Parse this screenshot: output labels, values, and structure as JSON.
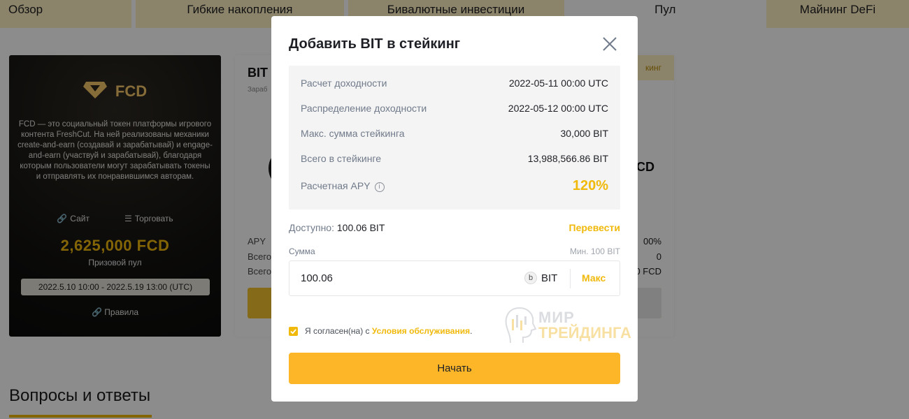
{
  "tabs": [
    {
      "label": "Обзор"
    },
    {
      "label": "Гибкие накопления"
    },
    {
      "label": "Бивалютные инвестиции"
    },
    {
      "label": "Пул"
    },
    {
      "label": "Майнинг DeFi"
    }
  ],
  "fcd_card": {
    "token": "FCD",
    "description": "FCD — это социальный токен платформы игрового контента FreshCut. На ней реализованы механики create-and-earn (создавай и зарабатывай) и engage-and-earn (участвуй и зарабатывай), благодаря которым пользователи могут зарабатывать токены и отправлять их понравившимся авторам.",
    "site_label": "Сайт",
    "trade_label": "Торговать",
    "prize_amount": "2,625,000 FCD",
    "prize_label": "Призовой пул",
    "period": "2022.5.10 10:00 - 2022.5.19 13:00 (UTC)",
    "rules_label": "Правила",
    "accent": "#f0b90b"
  },
  "pool_card": {
    "title": "BIT",
    "subtitle": "Зараб",
    "badge": "кинг",
    "right_token": "CD",
    "apy_label": "APY",
    "row2_label": "Всего",
    "row3_label": "Всего",
    "apy_value": "00%",
    "row2_value": "0",
    "row3_value": "0 FCD"
  },
  "faq": {
    "title": "Вопросы и ответы"
  },
  "modal": {
    "title": "Добавить BIT в стейкинг",
    "info": {
      "calc_label": "Расчет доходности",
      "calc_value": "2022-05-11 00:00 UTC",
      "dist_label": "Распределение доходности",
      "dist_value": "2022-05-12 00:00 UTC",
      "max_label": "Макс. сумма стейкинга",
      "max_value": "30,000 BIT",
      "total_label": "Всего в стейкинге",
      "total_value": "13,988,566.86 BIT",
      "apy_label": "Расчетная APY",
      "apy_value": "120%"
    },
    "available_label": "Доступно:",
    "available_value": "100.06 BIT",
    "transfer_label": "Перевести",
    "amount_label": "Сумма",
    "min_label": "Мин. 100 BIT",
    "amount_value": "100.06",
    "coin_glyph": "b",
    "unit": "BIT",
    "max_label_btn": "Макс",
    "agree_text": "Я согласен(на) с",
    "terms_label": "Условия обслуживания",
    "agree_suffix": ".",
    "start_label": "Начать",
    "accent": "#f0b90b"
  },
  "watermark": {
    "line1": "МИР",
    "line2": "ТРЕЙДИНГА"
  }
}
